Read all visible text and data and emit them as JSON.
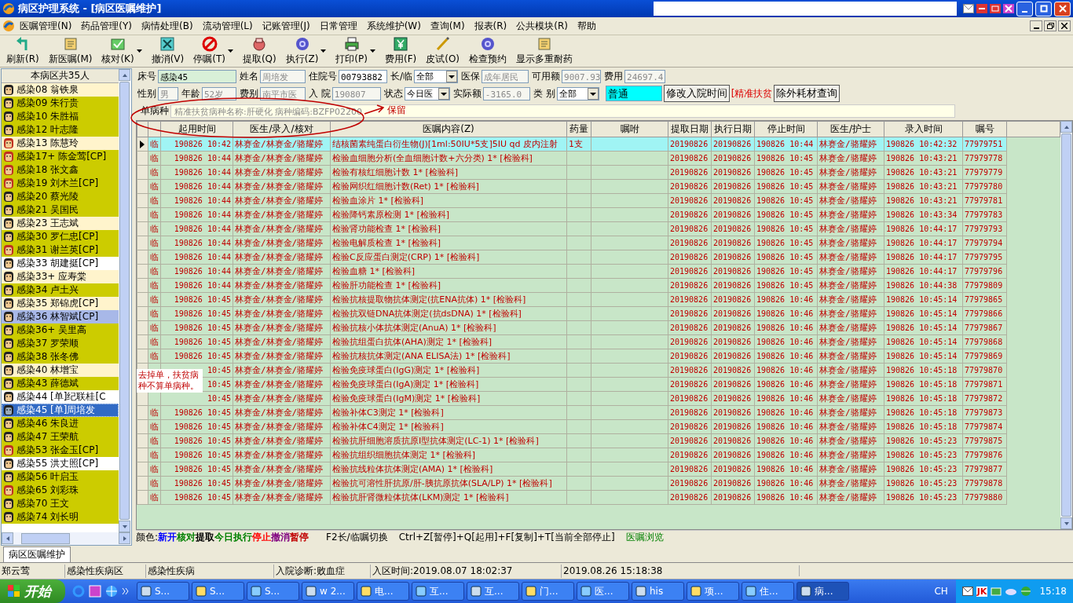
{
  "window": {
    "title": "病区护理系统 - [病区医嘱维护]"
  },
  "menu": [
    "医嘱管理(N)",
    "药品管理(Y)",
    "病情处理(B)",
    "流动管理(L)",
    "记账管理(J)",
    "日常管理",
    "系统维护(W)",
    "查询(M)",
    "报表(R)",
    "公共模块(R)",
    "帮助"
  ],
  "toolbar": [
    {
      "label": "刷新(R)",
      "dropdown": false
    },
    {
      "label": "新医嘱(M)",
      "dropdown": false
    },
    {
      "label": "核对(K)",
      "dropdown": true
    },
    {
      "label": "撤消(V)",
      "dropdown": false
    },
    {
      "label": "停嘱(T)",
      "dropdown": true
    },
    {
      "label": "提取(Q)",
      "dropdown": false
    },
    {
      "label": "执行(Z)",
      "dropdown": true
    },
    {
      "label": "打印(P)",
      "dropdown": true
    },
    {
      "label": "费用(F)",
      "dropdown": false
    },
    {
      "label": "皮试(O)",
      "dropdown": false
    },
    {
      "label": "检查预约",
      "dropdown": false
    },
    {
      "label": "显示多重耐药",
      "dropdown": false
    }
  ],
  "patients": {
    "header": "本病区共35人",
    "items": [
      {
        "label": "感染08 翁铁泉",
        "kind": "male",
        "color": "#fff4cc",
        "selected": false
      },
      {
        "label": "感染09 朱行贵",
        "kind": "male",
        "color": "#cccc00",
        "selected": false
      },
      {
        "label": "感染10 朱胜福",
        "kind": "male",
        "color": "#cccc00",
        "selected": false
      },
      {
        "label": "感染12 叶志隆",
        "kind": "male",
        "color": "#cccc00",
        "selected": false
      },
      {
        "label": "感染13 陈慧玲",
        "kind": "female",
        "color": "#fff4cc",
        "selected": false
      },
      {
        "label": "感染17+ 陈金莺[CP]",
        "kind": "female",
        "color": "#cccc00",
        "selected": false
      },
      {
        "label": "感染18 张文鑫",
        "kind": "female",
        "color": "#cccc00",
        "selected": false
      },
      {
        "label": "感染19 刘木兰[CP]",
        "kind": "female",
        "color": "#cccc00",
        "selected": false
      },
      {
        "label": "感染20 蔡光陵",
        "kind": "male",
        "color": "#cccc00",
        "selected": false
      },
      {
        "label": "感染21 吴国民",
        "kind": "male",
        "color": "#cccc00",
        "selected": false
      },
      {
        "label": "感染23 王志斌",
        "kind": "male",
        "color": "#fff4cc",
        "selected": false
      },
      {
        "label": "感染30 罗仁忠[CP]",
        "kind": "male",
        "color": "#cccc00",
        "selected": false
      },
      {
        "label": "感染31 谢兰英[CP]",
        "kind": "female",
        "color": "#cccc00",
        "selected": false
      },
      {
        "label": "感染33 胡建挺[CP]",
        "kind": "male",
        "color": "#ffffff",
        "selected": false
      },
      {
        "label": "感染33+ 应寿棠",
        "kind": "male",
        "color": "#fff4cc",
        "selected": false
      },
      {
        "label": "感染34 卢土兴",
        "kind": "male",
        "color": "#cccc00",
        "selected": false
      },
      {
        "label": "感染35 郑锦虎[CP]",
        "kind": "male",
        "color": "#fff4cc",
        "selected": false
      },
      {
        "label": "感染36 林智斌[CP]",
        "kind": "male",
        "color": "#a8b8e8",
        "selected": false
      },
      {
        "label": "感染36+ 吴里高",
        "kind": "male",
        "color": "#cccc00",
        "selected": false
      },
      {
        "label": "感染37 罗荣顺",
        "kind": "male",
        "color": "#cccc00",
        "selected": false
      },
      {
        "label": "感染38 张冬佛",
        "kind": "male",
        "color": "#cccc00",
        "selected": false
      },
      {
        "label": "感染40 林增宝",
        "kind": "male",
        "color": "#fff4cc",
        "selected": false
      },
      {
        "label": "感染43 薛德斌",
        "kind": "male",
        "color": "#cccc00",
        "selected": false
      },
      {
        "label": "感染44 [单]纪联桂[C",
        "kind": "male",
        "color": "#ffffff",
        "selected": false
      },
      {
        "label": "感染45 [单]周培发",
        "kind": "male",
        "color": "#316ac5",
        "selected": true
      },
      {
        "label": "感染46 朱良进",
        "kind": "male",
        "color": "#cccc00",
        "selected": false
      },
      {
        "label": "感染47 王荣航",
        "kind": "male",
        "color": "#cccc00",
        "selected": false
      },
      {
        "label": "感染53 张金玉[CP]",
        "kind": "female",
        "color": "#cccc00",
        "selected": false
      },
      {
        "label": "感染55 洪丈照[CP]",
        "kind": "male",
        "color": "#ffffff",
        "selected": false
      },
      {
        "label": "感染56 叶启玉",
        "kind": "male",
        "color": "#cccc00",
        "selected": false
      },
      {
        "label": "感染65 刘彩珠",
        "kind": "female",
        "color": "#cccc00",
        "selected": false
      },
      {
        "label": "感染70 王文",
        "kind": "male",
        "color": "#cccc00",
        "selected": false
      },
      {
        "label": "感染74 刘长明",
        "kind": "male",
        "color": "#cccc00",
        "selected": false
      }
    ]
  },
  "form": {
    "lines": [
      {
        "fields": [
          {
            "kind": "field",
            "label": "床号",
            "value": "感染45",
            "disabled": false
          },
          {
            "kind": "field",
            "label": "姓名",
            "value": "周培发",
            "disabled": true
          },
          {
            "kind": "field",
            "label": "住院号",
            "value": "00793882",
            "disabled": false
          },
          {
            "kind": "select",
            "label": "长/临",
            "value": "全部"
          },
          {
            "kind": "field",
            "label": "医保",
            "value": "成年居民",
            "disabled": true
          },
          {
            "kind": "field",
            "label": "可用额",
            "value": "9007.93",
            "disabled": true
          },
          {
            "kind": "field",
            "label": "费用",
            "value": "24697.4",
            "disabled": true
          }
        ]
      },
      {
        "fields": [
          {
            "kind": "field",
            "label": "性别",
            "value": "男",
            "disabled": true
          },
          {
            "kind": "field",
            "label": "年龄",
            "value": "52岁",
            "disabled": true
          },
          {
            "kind": "field",
            "label": "费别",
            "value": "南平市医",
            "disabled": true
          },
          {
            "kind": "field",
            "label": "入 院",
            "value": "190807",
            "disabled": true
          },
          {
            "kind": "select",
            "label": "状态",
            "value": "今日医"
          },
          {
            "kind": "field",
            "label": "实际额",
            "value": "-3165.0",
            "disabled": true
          },
          {
            "kind": "select",
            "label": "类 别",
            "value": "全部"
          },
          {
            "kind": "accent",
            "value": "普通"
          },
          {
            "kind": "button",
            "text": "修改入院时间"
          },
          {
            "kind": "note",
            "text": "[精准扶贫"
          },
          {
            "kind": "button",
            "text": "除外耗材查询"
          }
        ]
      },
      {
        "fields": [
          {
            "kind": "field",
            "label": "单病种",
            "value": "精准扶贫病种名称:肝硬化 病种编码:BZFP02200",
            "disabled": true
          }
        ]
      }
    ]
  },
  "annotation": {
    "note": "保留",
    "comment": "去掉单，扶贫病种不算单病种。"
  },
  "orders": {
    "columns": [
      "起用时间",
      "医生/录入/核对",
      "医嘱内容(Z)",
      "药量",
      "嘱咐",
      "提取日期",
      "执行日期",
      "停止时间",
      "医生/护士",
      "录入时间",
      "嘱号"
    ],
    "rows": [
      {
        "type": "临",
        "start": "190826 10:42",
        "doctor": "林赛金/林赛金/骆耀婷",
        "content": "结核菌素纯蛋白衍生物(J)[1ml:50IU*5支]5IU qd 皮内注射",
        "dose": "1支",
        "fetch": "20190826",
        "exec": "20190826",
        "stop": "190826 10:44",
        "nurse": "林赛金/骆耀婷",
        "entry": "190826 10:42:32",
        "number": "77979751",
        "selected": true
      },
      {
        "type": "临",
        "start": "190826 10:44",
        "doctor": "林赛金/林赛金/骆耀婷",
        "content": "检验血细胞分析(全血细胞计数+六分类)  1* [检验科]",
        "fetch": "20190826",
        "exec": "20190826",
        "stop": "190826 10:45",
        "nurse": "林赛金/骆耀婷",
        "entry": "190826 10:43:21",
        "number": "77979778",
        "selected": false
      },
      {
        "type": "临",
        "start": "190826 10:44",
        "doctor": "林赛金/林赛金/骆耀婷",
        "content": "检验有核红细胞计数  1* [检验科]",
        "fetch": "20190826",
        "exec": "20190826",
        "stop": "190826 10:45",
        "nurse": "林赛金/骆耀婷",
        "entry": "190826 10:43:21",
        "number": "77979779",
        "selected": false
      },
      {
        "type": "临",
        "start": "190826 10:44",
        "doctor": "林赛金/林赛金/骆耀婷",
        "content": "检验网织红细胞计数(Ret)  1* [检验科]",
        "fetch": "20190826",
        "exec": "20190826",
        "stop": "190826 10:45",
        "nurse": "林赛金/骆耀婷",
        "entry": "190826 10:43:21",
        "number": "77979780",
        "selected": false
      },
      {
        "type": "临",
        "start": "190826 10:44",
        "doctor": "林赛金/林赛金/骆耀婷",
        "content": "检验血涂片  1* [检验科]",
        "fetch": "20190826",
        "exec": "20190826",
        "stop": "190826 10:45",
        "nurse": "林赛金/骆耀婷",
        "entry": "190826 10:43:21",
        "number": "77979781",
        "selected": false
      },
      {
        "type": "临",
        "start": "190826 10:44",
        "doctor": "林赛金/林赛金/骆耀婷",
        "content": "检验降钙素原检测  1* [检验科]",
        "fetch": "20190826",
        "exec": "20190826",
        "stop": "190826 10:45",
        "nurse": "林赛金/骆耀婷",
        "entry": "190826 10:43:34",
        "number": "77979783",
        "selected": false
      },
      {
        "type": "临",
        "start": "190826 10:44",
        "doctor": "林赛金/林赛金/骆耀婷",
        "content": "检验肾功能检查  1* [检验科]",
        "fetch": "20190826",
        "exec": "20190826",
        "stop": "190826 10:45",
        "nurse": "林赛金/骆耀婷",
        "entry": "190826 10:44:17",
        "number": "77979793",
        "selected": false
      },
      {
        "type": "临",
        "start": "190826 10:44",
        "doctor": "林赛金/林赛金/骆耀婷",
        "content": "检验电解质检查  1* [检验科]",
        "fetch": "20190826",
        "exec": "20190826",
        "stop": "190826 10:45",
        "nurse": "林赛金/骆耀婷",
        "entry": "190826 10:44:17",
        "number": "77979794",
        "selected": false
      },
      {
        "type": "临",
        "start": "190826 10:44",
        "doctor": "林赛金/林赛金/骆耀婷",
        "content": "检验C反应蛋白测定(CRP)  1* [检验科]",
        "fetch": "20190826",
        "exec": "20190826",
        "stop": "190826 10:45",
        "nurse": "林赛金/骆耀婷",
        "entry": "190826 10:44:17",
        "number": "77979795",
        "selected": false
      },
      {
        "type": "临",
        "start": "190826 10:44",
        "doctor": "林赛金/林赛金/骆耀婷",
        "content": "检验血糖  1* [检验科]",
        "fetch": "20190826",
        "exec": "20190826",
        "stop": "190826 10:45",
        "nurse": "林赛金/骆耀婷",
        "entry": "190826 10:44:17",
        "number": "77979796",
        "selected": false
      },
      {
        "type": "临",
        "start": "190826 10:44",
        "doctor": "林赛金/林赛金/骆耀婷",
        "content": "检验肝功能检查  1* [检验科]",
        "fetch": "20190826",
        "exec": "20190826",
        "stop": "190826 10:45",
        "nurse": "林赛金/骆耀婷",
        "entry": "190826 10:44:38",
        "number": "77979809",
        "selected": false
      },
      {
        "type": "临",
        "start": "190826 10:45",
        "doctor": "林赛金/林赛金/骆耀婷",
        "content": "检验抗核提取物抗体测定(抗ENA抗体)  1* [检验科]",
        "fetch": "20190826",
        "exec": "20190826",
        "stop": "190826 10:46",
        "nurse": "林赛金/骆耀婷",
        "entry": "190826 10:45:14",
        "number": "77979865",
        "selected": false
      },
      {
        "type": "临",
        "start": "190826 10:45",
        "doctor": "林赛金/林赛金/骆耀婷",
        "content": "检验抗双链DNA抗体测定(抗dsDNA)  1* [检验科]",
        "fetch": "20190826",
        "exec": "20190826",
        "stop": "190826 10:46",
        "nurse": "林赛金/骆耀婷",
        "entry": "190826 10:45:14",
        "number": "77979866",
        "selected": false
      },
      {
        "type": "临",
        "start": "190826 10:45",
        "doctor": "林赛金/林赛金/骆耀婷",
        "content": "检验抗核小体抗体测定(AnuA)  1* [检验科]",
        "fetch": "20190826",
        "exec": "20190826",
        "stop": "190826 10:46",
        "nurse": "林赛金/骆耀婷",
        "entry": "190826 10:45:14",
        "number": "77979867",
        "selected": false
      },
      {
        "type": "临",
        "start": "190826 10:45",
        "doctor": "林赛金/林赛金/骆耀婷",
        "content": "检验抗组蛋白抗体(AHA)测定  1* [检验科]",
        "fetch": "20190826",
        "exec": "20190826",
        "stop": "190826 10:46",
        "nurse": "林赛金/骆耀婷",
        "entry": "190826 10:45:14",
        "number": "77979868",
        "selected": false
      },
      {
        "type": "临",
        "start": "190826 10:45",
        "doctor": "林赛金/林赛金/骆耀婷",
        "content": "检验抗核抗体测定(ANA ELISA法)  1* [检验科]",
        "fetch": "20190826",
        "exec": "20190826",
        "stop": "190826 10:46",
        "nurse": "林赛金/骆耀婷",
        "entry": "190826 10:45:14",
        "number": "77979869",
        "selected": false
      },
      {
        "start": "10:45",
        "doctor": "林赛金/林赛金/骆耀婷",
        "content": "检验免疫球蛋白(IgG)测定  1* [检验科]",
        "fetch": "20190826",
        "exec": "20190826",
        "stop": "190826 10:46",
        "nurse": "林赛金/骆耀婷",
        "entry": "190826 10:45:18",
        "number": "77979870",
        "selected": false
      },
      {
        "start": "10:45",
        "doctor": "林赛金/林赛金/骆耀婷",
        "content": "检验免疫球蛋白(IgA)测定  1* [检验科]",
        "fetch": "20190826",
        "exec": "20190826",
        "stop": "190826 10:46",
        "nurse": "林赛金/骆耀婷",
        "entry": "190826 10:45:18",
        "number": "77979871",
        "selected": false
      },
      {
        "start": "10:45",
        "doctor": "林赛金/林赛金/骆耀婷",
        "content": "检验免疫球蛋白(IgM)测定  1* [检验科]",
        "fetch": "20190826",
        "exec": "20190826",
        "stop": "190826 10:46",
        "nurse": "林赛金/骆耀婷",
        "entry": "190826 10:45:18",
        "number": "77979872",
        "selected": false
      },
      {
        "type": "临",
        "start": "190826 10:45",
        "doctor": "林赛金/林赛金/骆耀婷",
        "content": "检验补体C3测定  1* [检验科]",
        "fetch": "20190826",
        "exec": "20190826",
        "stop": "190826 10:46",
        "nurse": "林赛金/骆耀婷",
        "entry": "190826 10:45:18",
        "number": "77979873",
        "selected": false
      },
      {
        "type": "临",
        "start": "190826 10:45",
        "doctor": "林赛金/林赛金/骆耀婷",
        "content": "检验补体C4测定  1* [检验科]",
        "fetch": "20190826",
        "exec": "20190826",
        "stop": "190826 10:46",
        "nurse": "林赛金/骆耀婷",
        "entry": "190826 10:45:18",
        "number": "77979874",
        "selected": false
      },
      {
        "type": "临",
        "start": "190826 10:45",
        "doctor": "林赛金/林赛金/骆耀婷",
        "content": "检验抗肝细胞溶质抗原I型抗体测定(LC-1)  1* [检验科]",
        "fetch": "20190826",
        "exec": "20190826",
        "stop": "190826 10:46",
        "nurse": "林赛金/骆耀婷",
        "entry": "190826 10:45:23",
        "number": "77979875",
        "selected": false
      },
      {
        "type": "临",
        "start": "190826 10:45",
        "doctor": "林赛金/林赛金/骆耀婷",
        "content": "检验抗组织细胞抗体测定  1* [检验科]",
        "fetch": "20190826",
        "exec": "20190826",
        "stop": "190826 10:46",
        "nurse": "林赛金/骆耀婷",
        "entry": "190826 10:45:23",
        "number": "77979876",
        "selected": false
      },
      {
        "type": "临",
        "start": "190826 10:45",
        "doctor": "林赛金/林赛金/骆耀婷",
        "content": "检验抗线粒体抗体测定(AMA)  1* [检验科]",
        "fetch": "20190826",
        "exec": "20190826",
        "stop": "190826 10:46",
        "nurse": "林赛金/骆耀婷",
        "entry": "190826 10:45:23",
        "number": "77979877",
        "selected": false
      },
      {
        "type": "临",
        "start": "190826 10:45",
        "doctor": "林赛金/林赛金/骆耀婷",
        "content": "检验抗可溶性肝抗原/肝-胰抗原抗体(SLA/LP)  1* [检验科]",
        "fetch": "20190826",
        "exec": "20190826",
        "stop": "190826 10:46",
        "nurse": "林赛金/骆耀婷",
        "entry": "190826 10:45:23",
        "number": "77979878",
        "selected": false
      },
      {
        "type": "临",
        "start": "190826 10:45",
        "doctor": "林赛金/林赛金/骆耀婷",
        "content": "检验抗肝肾微粒体抗体(LKM)测定  1* [检验科]",
        "fetch": "20190826",
        "exec": "20190826",
        "stop": "190826 10:46",
        "nurse": "林赛金/骆耀婷",
        "entry": "190826 10:45:23",
        "number": "77979880",
        "selected": false
      }
    ]
  },
  "legend": {
    "label": "颜色:",
    "items": [
      {
        "text": "新开",
        "color": "#0000ff"
      },
      {
        "text": "核对",
        "color": "#008000"
      },
      {
        "text": "提取",
        "color": "#000000"
      },
      {
        "text": "今日执行",
        "color": "#008000"
      },
      {
        "text": "停止",
        "color": "#ff0000"
      },
      {
        "text": "撤消",
        "color": "#800080"
      },
      {
        "text": "暂停",
        "color": "#c00000"
      }
    ],
    "hints": [
      "F2长/临嘱切换",
      "Ctrl+Z[暂停]+Q[起用]+F[复制]+T[当前全部停止]"
    ],
    "link": "医嘱浏览"
  },
  "tabs": [
    {
      "label": "病区医嘱维护",
      "selected": true
    }
  ],
  "status_bar": [
    "郑云莺",
    "感染性疾病区",
    "感染性疾病",
    "入院诊断:败血症",
    "入区时间:2019.08.07 18:02:37",
    "2019.08.26 15:18:38"
  ],
  "taskbar": {
    "start": "开始",
    "tasks": [
      {
        "label": "S...",
        "selected": false
      },
      {
        "label": "S...",
        "selected": false
      },
      {
        "label": "S...",
        "selected": false
      },
      {
        "label": "w 2...",
        "selected": false
      },
      {
        "label": "电...",
        "selected": false
      },
      {
        "label": "互...",
        "selected": false
      },
      {
        "label": "互...",
        "selected": false
      },
      {
        "label": "门...",
        "selected": false
      },
      {
        "label": "医...",
        "selected": false
      },
      {
        "label": "his",
        "selected": false
      },
      {
        "label": "项...",
        "selected": false
      },
      {
        "label": "住...",
        "selected": false
      },
      {
        "label": "病...",
        "selected": true
      }
    ],
    "lang": "CH",
    "tray_label": "JK",
    "clock": "15:18"
  }
}
